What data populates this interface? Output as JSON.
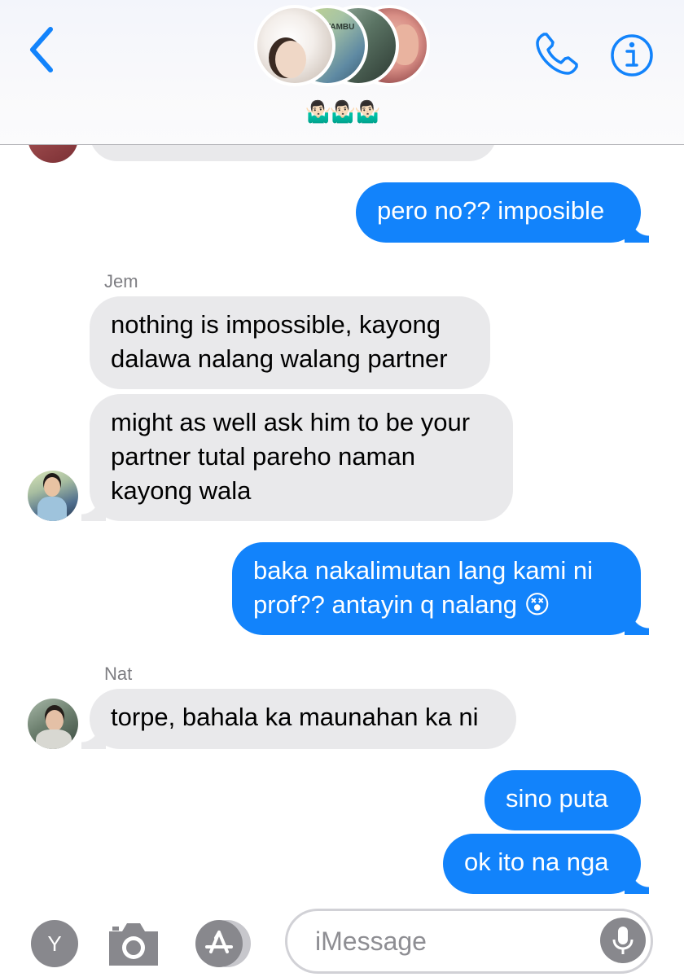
{
  "header": {
    "group_name": "🤷🏻‍♂️🤷🏻‍♂️🤷🏻‍♂️",
    "icons": [
      "back-chevron-icon",
      "phone-icon",
      "info-icon"
    ]
  },
  "messages": [
    {
      "from": "me",
      "text": "pero no?? imposible"
    },
    {
      "from": "Jem",
      "sender_label": "Jem",
      "text": "nothing is impossible, kayong dalawa nalang walang partner"
    },
    {
      "from": "Jem",
      "text": "might as well ask him to be your partner tutal pareho naman kayong wala"
    },
    {
      "from": "me",
      "text": "baka nakalimutan lang kami ni prof?? antayin q nalang 😵"
    },
    {
      "from": "Nat",
      "sender_label": "Nat",
      "text": "torpe, bahala ka maunahan ka ni"
    },
    {
      "from": "me",
      "text": "sino puta"
    },
    {
      "from": "me",
      "text": "ok ito na nga"
    }
  ],
  "composer": {
    "y_button_label": "Y",
    "placeholder": "iMessage",
    "icons": [
      "camera-icon",
      "app-store-icon",
      "microphone-icon"
    ]
  },
  "colors": {
    "accent": "#1283fb",
    "received_bubble": "#e9e9eb",
    "sender_label": "#7d7d82",
    "icon_gray": "#88888d"
  }
}
